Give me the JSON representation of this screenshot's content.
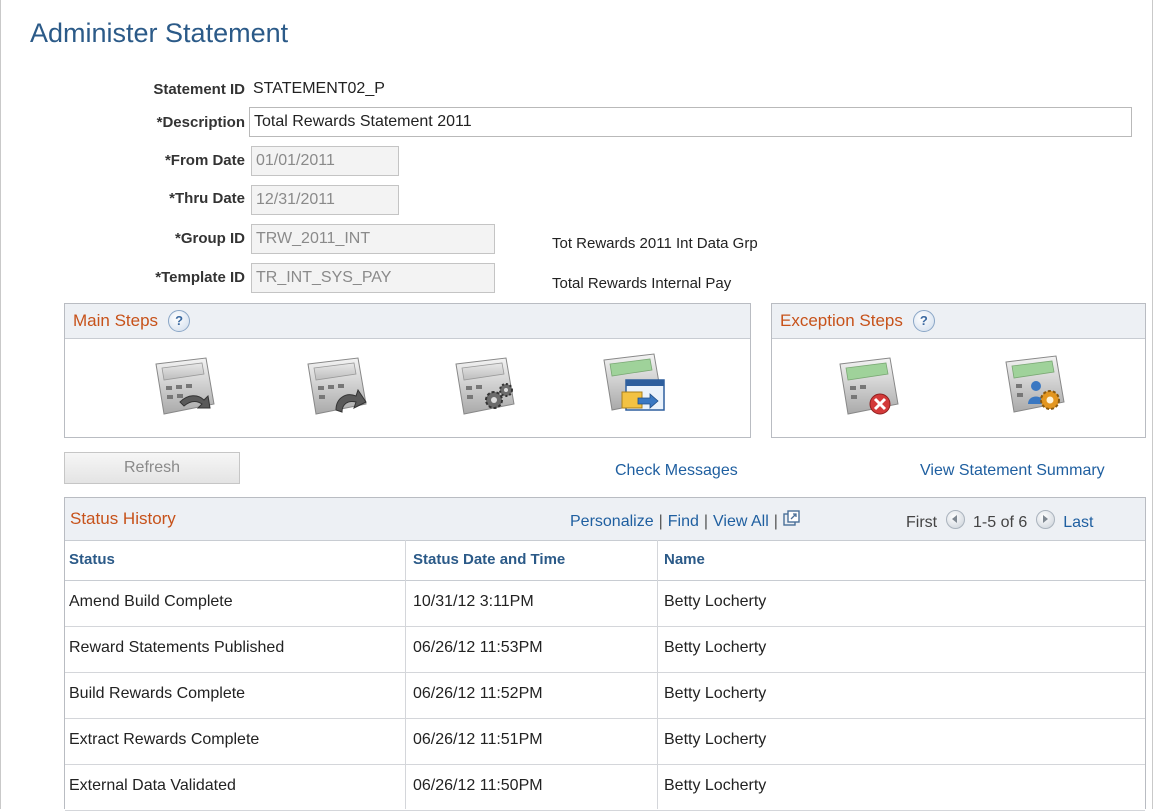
{
  "page": {
    "title": "Administer Statement"
  },
  "form": {
    "statement_id_label": "Statement ID",
    "statement_id_value": "STATEMENT02_P",
    "description_label": "*Description",
    "description_value": "Total Rewards Statement 2011",
    "from_date_label": "*From Date",
    "from_date_value": "01/01/2011",
    "thru_date_label": "*Thru Date",
    "thru_date_value": "12/31/2011",
    "group_id_label": "*Group ID",
    "group_id_value": "TRW_2011_INT",
    "group_id_desc": "Tot Rewards 2011 Int Data Grp",
    "template_id_label": "*Template ID",
    "template_id_value": "TR_INT_SYS_PAY",
    "template_id_desc": "Total Rewards Internal Pay"
  },
  "main_steps": {
    "title": "Main Steps",
    "icons": [
      "extract-rewards-icon",
      "build-rewards-icon",
      "process-settings-icon",
      "publish-statements-icon"
    ]
  },
  "exception_steps": {
    "title": "Exception Steps",
    "icons": [
      "cancel-statement-icon",
      "user-settings-icon"
    ]
  },
  "actions": {
    "refresh_label": "Refresh",
    "check_messages_label": "Check Messages",
    "view_summary_label": "View Statement Summary"
  },
  "status_history": {
    "title": "Status History",
    "nav": {
      "personalize": "Personalize",
      "find": "Find",
      "view_all": "View All"
    },
    "pager": {
      "first": "First",
      "range": "1-5 of 6",
      "last": "Last"
    },
    "columns": [
      "Status",
      "Status Date and Time",
      "Name"
    ],
    "rows": [
      {
        "status": "Amend Build Complete",
        "datetime": "10/31/12  3:11PM",
        "name": "Betty Locherty"
      },
      {
        "status": "Reward Statements Published",
        "datetime": "06/26/12 11:53PM",
        "name": "Betty Locherty"
      },
      {
        "status": "Build Rewards Complete",
        "datetime": "06/26/12 11:52PM",
        "name": "Betty Locherty"
      },
      {
        "status": "Extract Rewards Complete",
        "datetime": "06/26/12 11:51PM",
        "name": "Betty Locherty"
      },
      {
        "status": "External Data Validated",
        "datetime": "06/26/12 11:50PM",
        "name": "Betty Locherty"
      }
    ]
  },
  "colors": {
    "title": "#2b5a88",
    "section_title": "#c7521a",
    "link": "#1f5fa0",
    "header_bg": "#edf0f4"
  }
}
